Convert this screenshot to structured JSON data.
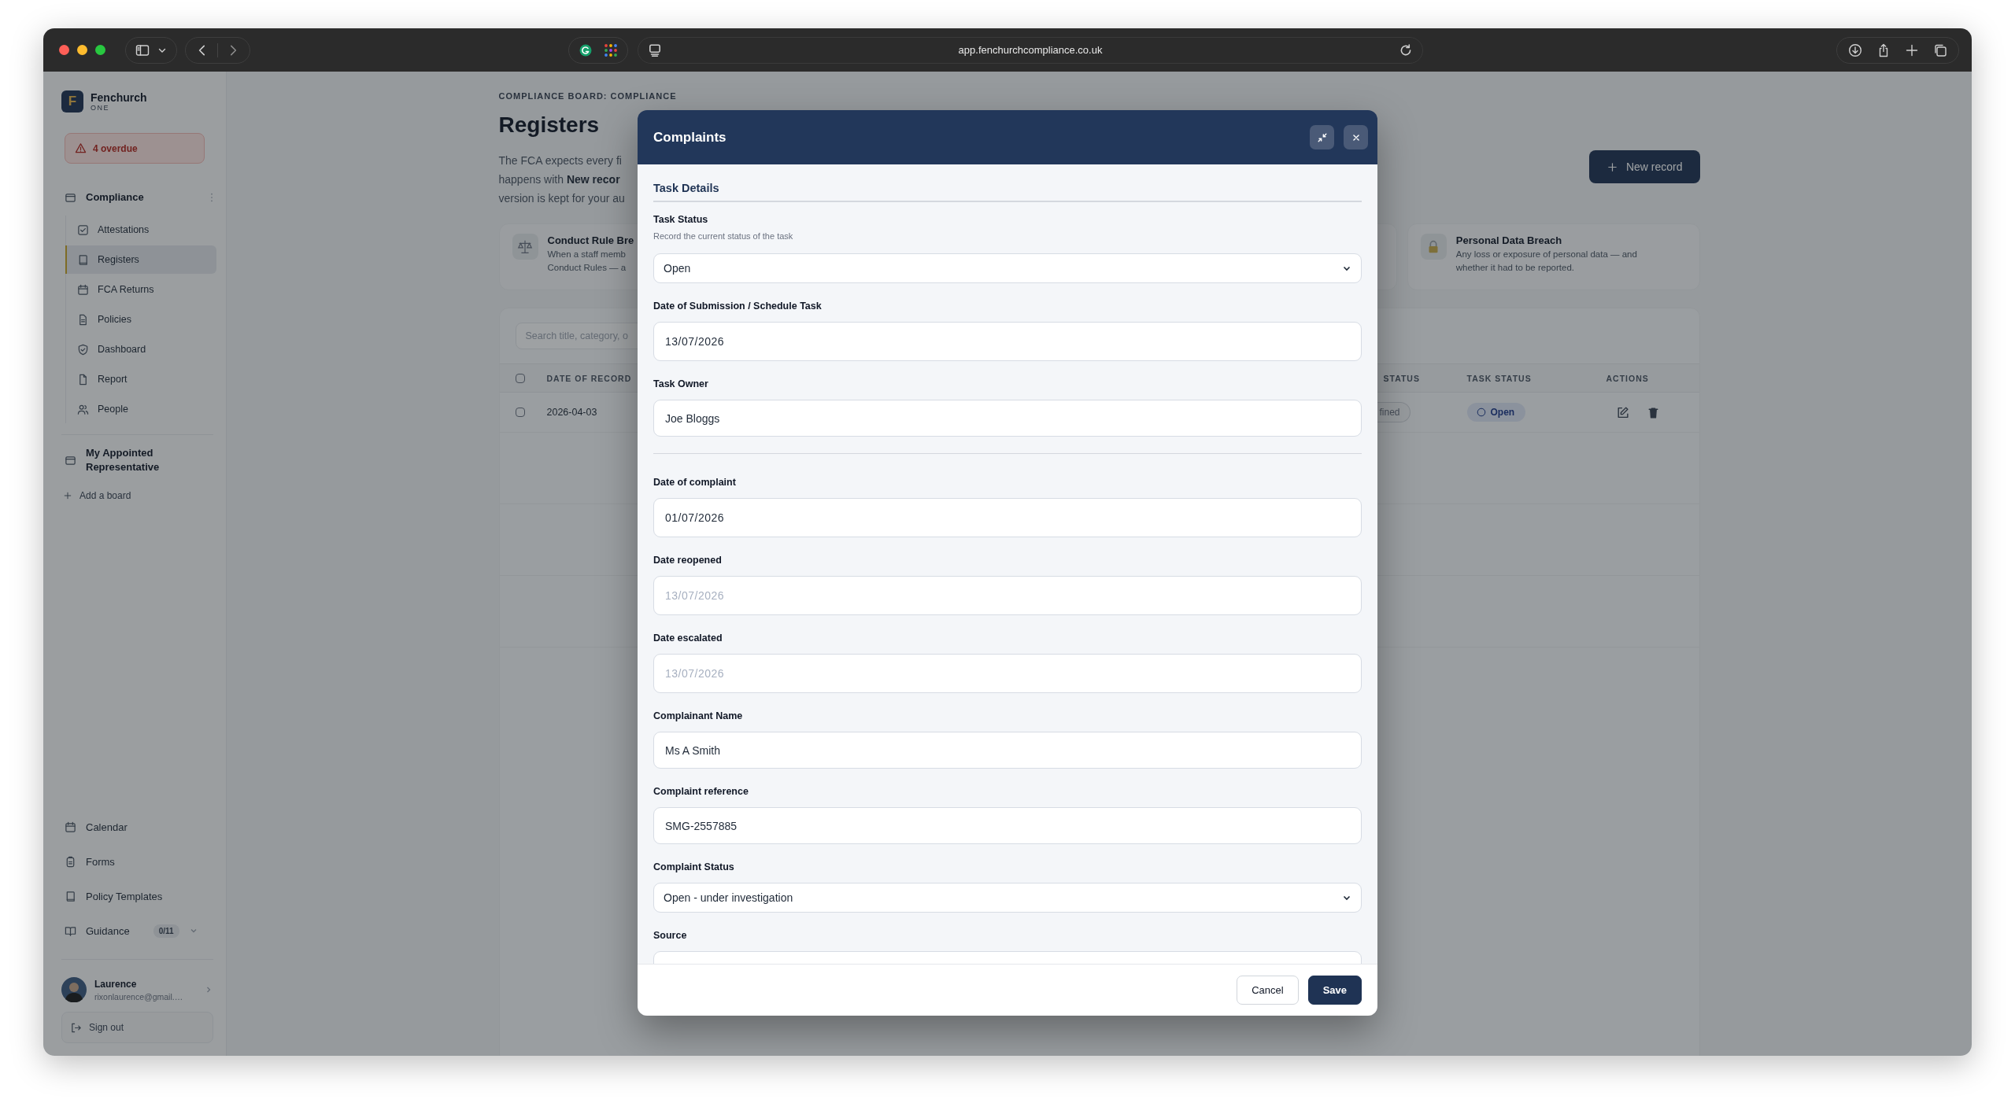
{
  "browser": {
    "url": "app.fenchurchcompliance.co.uk"
  },
  "sidebar": {
    "logo_letter": "F",
    "brand": "Fenchurch",
    "brand_sub": "ONE",
    "overdue": "4 overdue",
    "board": {
      "title": "Compliance",
      "items": [
        {
          "label": "Attestations",
          "selected": false
        },
        {
          "label": "Registers",
          "selected": true
        },
        {
          "label": "FCA Returns",
          "selected": false
        },
        {
          "label": "Policies",
          "selected": false
        },
        {
          "label": "Dashboard",
          "selected": false
        },
        {
          "label": "Report",
          "selected": false
        },
        {
          "label": "People",
          "selected": false
        }
      ]
    },
    "second_board": "My Appointed Representative",
    "add_board": "Add a board",
    "bottom_items": [
      {
        "label": "Calendar"
      },
      {
        "label": "Forms"
      },
      {
        "label": "Policy Templates"
      },
      {
        "label": "Guidance",
        "badge": "0/11"
      }
    ],
    "user": {
      "name": "Laurence",
      "email": "rixonlaurence@gmail.…"
    },
    "sign_out": "Sign out"
  },
  "page": {
    "eyebrow": "COMPLIANCE BOARD: COMPLIANCE",
    "title": "Registers",
    "intro": [
      "The FCA expects every fi",
      "happens with **New recor**",
      "version is kept for your au"
    ],
    "new_record": "New record",
    "cards": [
      {
        "title": "Conduct Rule Bre",
        "lines": [
          "When a staff memb",
          "Conduct Rules — a"
        ]
      },
      {
        "title": "Personal Data Breach",
        "lines": [
          "Any loss or exposure of personal data — and",
          "whether it had to be reported."
        ]
      }
    ],
    "table": {
      "select_all": {
        "checked": false
      },
      "search_placeholder": "Search title, category, o",
      "columns": [
        "DATE OF RECORD",
        "STATUS",
        "TASK STATUS",
        "ACTIONS"
      ],
      "rows": [
        {
          "selected": false,
          "date": "2026-04-03",
          "status": "fined",
          "task_status": "Open"
        }
      ]
    }
  },
  "modal": {
    "title": "Complaints",
    "section": "Task Details",
    "groups": [
      [
        {
          "kind": "select",
          "label": "Task Status",
          "hint": "Record the current status of the task",
          "value": "Open"
        },
        {
          "kind": "date",
          "label": "Date of Submission / Schedule Task",
          "value": "13/07/2026"
        },
        {
          "kind": "text",
          "label": "Task Owner",
          "value": "Joe Bloggs"
        }
      ],
      [
        {
          "kind": "date",
          "label": "Date of complaint",
          "value": "01/07/2026"
        },
        {
          "kind": "date",
          "label": "Date reopened",
          "placeholder": "13/07/2026"
        },
        {
          "kind": "date",
          "label": "Date escalated",
          "placeholder": "13/07/2026"
        },
        {
          "kind": "text",
          "label": "Complainant Name",
          "value": "Ms A Smith"
        },
        {
          "kind": "text",
          "label": "Complaint reference",
          "value": "SMG-2557885"
        },
        {
          "kind": "select",
          "label": "Complaint Status",
          "value": "Open - under investigation"
        },
        {
          "kind": "text",
          "label": "Source"
        }
      ]
    ],
    "buttons": [
      {
        "kind": "secondary",
        "label": "Cancel"
      },
      {
        "kind": "primary",
        "label": "Save"
      }
    ]
  }
}
